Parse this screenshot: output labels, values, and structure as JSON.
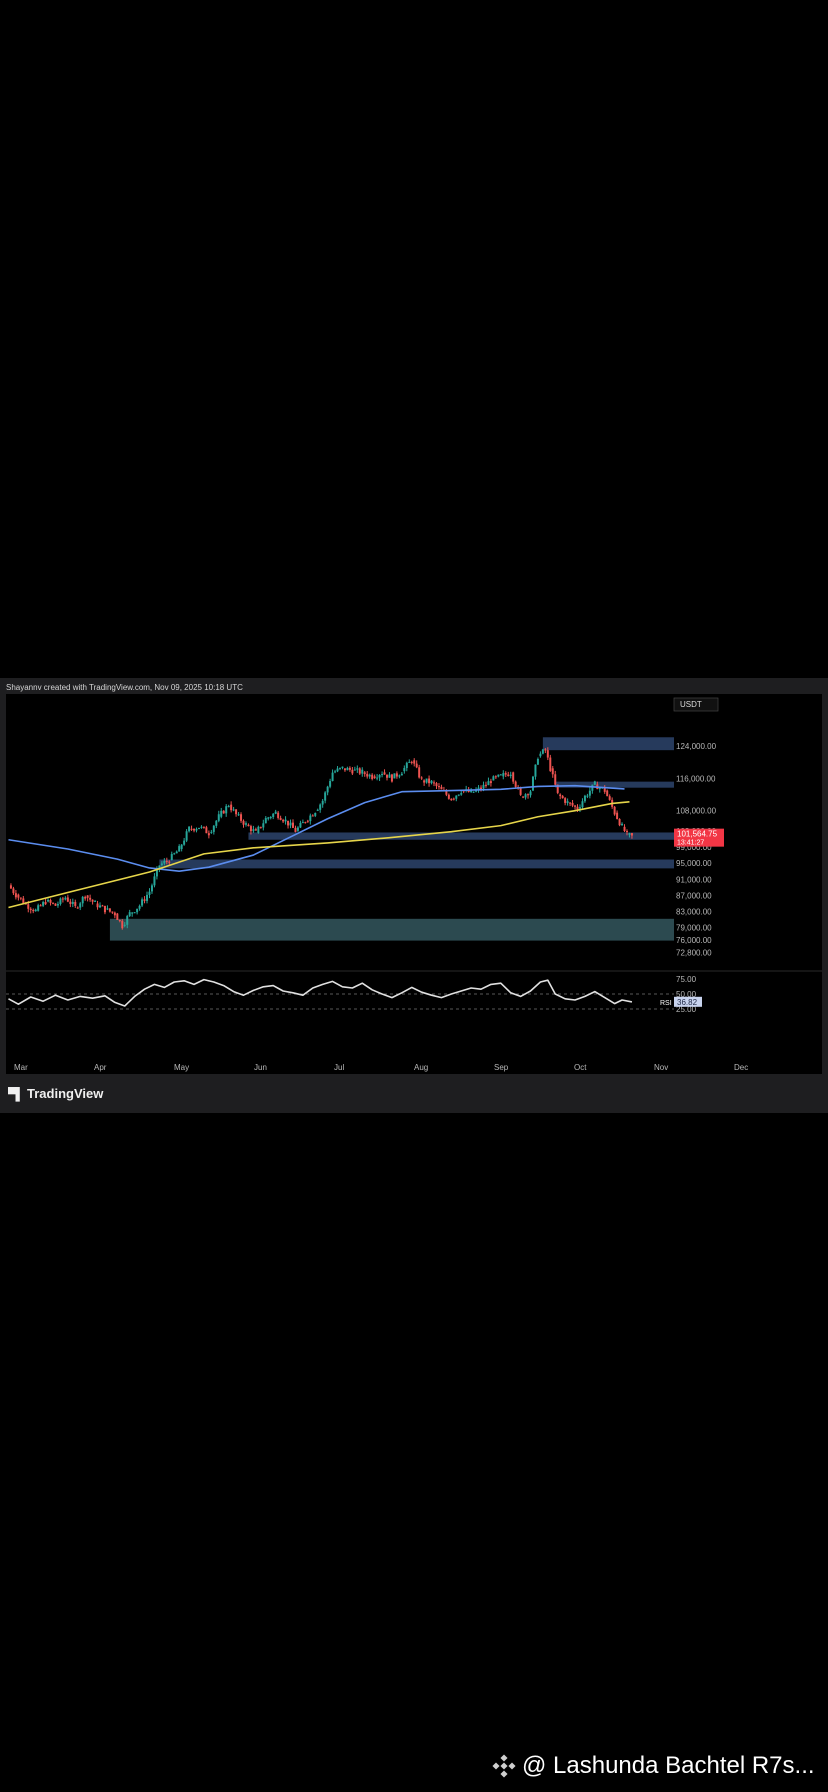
{
  "credit": "Shayannv created with TradingView.com, Nov 09, 2025 10:18 UTC",
  "brand": {
    "name": "TradingView",
    "icon": "tradingview-logo-icon"
  },
  "watermark": {
    "text": "@ Lashunda Bachtel R7s...",
    "icon": "binance-diamond-icon"
  },
  "colors": {
    "background": "#000000",
    "frame": "#1e1e20",
    "zone_blue": "#263a5c",
    "zone_teal": "#2c4a50",
    "candle_up": "#26a69a",
    "candle_down": "#ef5350",
    "ma_blue": "#5b8def",
    "ma_yellow": "#e6d54a",
    "rsi_line": "#e0e0e0",
    "price_tag": "#f23645"
  },
  "chart_data": [
    {
      "type": "candlestick",
      "title": "",
      "currency": "USDT",
      "x_labels": [
        "Mar",
        "Apr",
        "May",
        "Jun",
        "Jul",
        "Aug",
        "Sep",
        "Oct",
        "Nov",
        "Dec"
      ],
      "y_ticks": [
        124000,
        116000,
        108000,
        103000,
        99000,
        95000,
        91000,
        87000,
        83000,
        79000,
        76000,
        72800
      ],
      "y_tick_labels": [
        "124,000.00",
        "116,000.00",
        "108,000.00",
        "103,000.00",
        "99,000.00",
        "95,000.00",
        "91,000.00",
        "87,000.00",
        "83,000.00",
        "79,000.00",
        "76,000.00",
        "72,800.00"
      ],
      "ylim": [
        70000,
        128000
      ],
      "last_price": {
        "value": 101564.75,
        "label": "101,564.75",
        "countdown": "13:41:27"
      },
      "closes": [
        [
          1,
          89500
        ],
        [
          4,
          87200
        ],
        [
          8,
          84800
        ],
        [
          12,
          83200
        ],
        [
          16,
          85500
        ],
        [
          20,
          84500
        ],
        [
          24,
          86500
        ],
        [
          28,
          84000
        ],
        [
          32,
          87000
        ],
        [
          36,
          85000
        ],
        [
          40,
          83500
        ],
        [
          44,
          82500
        ],
        [
          47,
          79500
        ],
        [
          50,
          82500
        ],
        [
          54,
          84500
        ],
        [
          58,
          88000
        ],
        [
          62,
          94500
        ],
        [
          66,
          95800
        ],
        [
          70,
          98500
        ],
        [
          74,
          103500
        ],
        [
          78,
          104000
        ],
        [
          82,
          102500
        ],
        [
          86,
          106500
        ],
        [
          90,
          109500
        ],
        [
          93,
          107000
        ],
        [
          97,
          104500
        ],
        [
          101,
          102500
        ],
        [
          105,
          106000
        ],
        [
          109,
          107500
        ],
        [
          113,
          105500
        ],
        [
          117,
          103000
        ],
        [
          121,
          105500
        ],
        [
          125,
          108000
        ],
        [
          128,
          110500
        ],
        [
          132,
          117500
        ],
        [
          136,
          118500
        ],
        [
          140,
          118000
        ],
        [
          144,
          117500
        ],
        [
          148,
          116500
        ],
        [
          152,
          117500
        ],
        [
          156,
          116000
        ],
        [
          160,
          117800
        ],
        [
          164,
          120500
        ],
        [
          168,
          115500
        ],
        [
          172,
          115000
        ],
        [
          176,
          113000
        ],
        [
          180,
          111000
        ],
        [
          184,
          113000
        ],
        [
          188,
          112500
        ],
        [
          192,
          113500
        ],
        [
          196,
          115500
        ],
        [
          200,
          116500
        ],
        [
          204,
          117500
        ],
        [
          208,
          111500
        ],
        [
          212,
          113000
        ],
        [
          215,
          121500
        ],
        [
          218,
          123000
        ],
        [
          220,
          118500
        ],
        [
          223,
          112000
        ],
        [
          227,
          110000
        ],
        [
          231,
          108500
        ],
        [
          234,
          111500
        ],
        [
          238,
          114500
        ],
        [
          242,
          113000
        ],
        [
          246,
          107500
        ],
        [
          249,
          104000
        ],
        [
          251,
          102000
        ],
        [
          253,
          101564
        ]
      ],
      "ma_blue": [
        [
          1,
          100800
        ],
        [
          25,
          98500
        ],
        [
          45,
          96000
        ],
        [
          58,
          93800
        ],
        [
          70,
          93000
        ],
        [
          82,
          94000
        ],
        [
          100,
          97000
        ],
        [
          115,
          101500
        ],
        [
          130,
          106000
        ],
        [
          145,
          110000
        ],
        [
          160,
          112700
        ],
        [
          180,
          113000
        ],
        [
          200,
          113300
        ],
        [
          215,
          114000
        ],
        [
          230,
          114200
        ],
        [
          250,
          113400
        ]
      ],
      "ma_yellow": [
        [
          1,
          84000
        ],
        [
          30,
          88500
        ],
        [
          58,
          92800
        ],
        [
          80,
          97300
        ],
        [
          100,
          98800
        ],
        [
          130,
          100000
        ],
        [
          155,
          101300
        ],
        [
          180,
          102800
        ],
        [
          200,
          104300
        ],
        [
          215,
          106500
        ],
        [
          230,
          108000
        ],
        [
          245,
          109800
        ],
        [
          252,
          110200
        ]
      ],
      "zones": [
        {
          "from": 123000,
          "to": 126200,
          "x_start": 217,
          "color": "zone_blue"
        },
        {
          "from": 113700,
          "to": 115200,
          "x_start": 222,
          "color": "zone_blue"
        },
        {
          "from": 100800,
          "to": 102600,
          "x_start": 98,
          "color": "zone_blue"
        },
        {
          "from": 93700,
          "to": 95900,
          "x_start": 62,
          "color": "zone_blue"
        },
        {
          "from": 75800,
          "to": 81200,
          "x_start": 42,
          "color": "zone_teal"
        }
      ]
    },
    {
      "type": "line",
      "series_label": "RSI",
      "last_value_label": "36.82",
      "y_ticks": [
        75,
        50,
        25
      ],
      "y_tick_labels": [
        "75.00",
        "50.00",
        "25.00"
      ],
      "ylim": [
        20,
        80
      ],
      "values": [
        [
          1,
          42
        ],
        [
          5,
          33
        ],
        [
          10,
          45
        ],
        [
          15,
          38
        ],
        [
          20,
          48
        ],
        [
          25,
          40
        ],
        [
          30,
          46
        ],
        [
          35,
          43
        ],
        [
          40,
          47
        ],
        [
          44,
          36
        ],
        [
          48,
          30
        ],
        [
          52,
          46
        ],
        [
          56,
          58
        ],
        [
          60,
          66
        ],
        [
          64,
          61
        ],
        [
          68,
          70
        ],
        [
          72,
          72
        ],
        [
          76,
          66
        ],
        [
          80,
          74
        ],
        [
          84,
          70
        ],
        [
          88,
          64
        ],
        [
          92,
          54
        ],
        [
          96,
          48
        ],
        [
          100,
          56
        ],
        [
          104,
          62
        ],
        [
          108,
          64
        ],
        [
          112,
          55
        ],
        [
          116,
          52
        ],
        [
          120,
          48
        ],
        [
          124,
          60
        ],
        [
          128,
          66
        ],
        [
          132,
          71
        ],
        [
          136,
          62
        ],
        [
          140,
          60
        ],
        [
          144,
          68
        ],
        [
          148,
          57
        ],
        [
          152,
          50
        ],
        [
          156,
          44
        ],
        [
          160,
          52
        ],
        [
          164,
          61
        ],
        [
          168,
          53
        ],
        [
          172,
          48
        ],
        [
          176,
          44
        ],
        [
          180,
          50
        ],
        [
          184,
          55
        ],
        [
          188,
          60
        ],
        [
          192,
          58
        ],
        [
          196,
          66
        ],
        [
          200,
          68
        ],
        [
          204,
          52
        ],
        [
          208,
          46
        ],
        [
          212,
          55
        ],
        [
          216,
          70
        ],
        [
          219,
          73
        ],
        [
          222,
          50
        ],
        [
          226,
          42
        ],
        [
          230,
          40
        ],
        [
          234,
          46
        ],
        [
          238,
          54
        ],
        [
          242,
          44
        ],
        [
          246,
          34
        ],
        [
          249,
          40
        ],
        [
          253,
          36.8
        ]
      ]
    }
  ]
}
